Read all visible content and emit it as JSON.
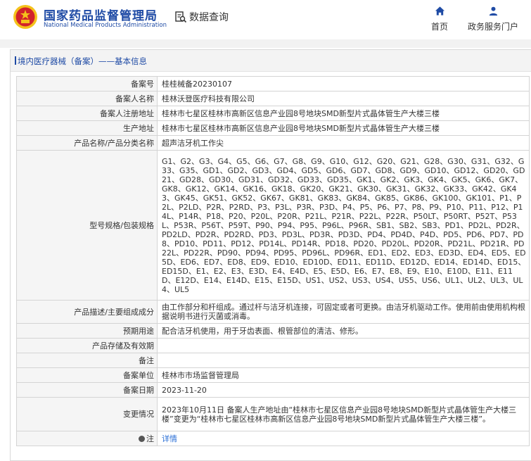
{
  "header": {
    "site_name_cn": "国家药品监督管理局",
    "site_name_en": "National Medical Products Administration",
    "data_query_label": "数据查询",
    "nav_home": "首页",
    "nav_portal": "政务服务门户"
  },
  "breadcrumb": {
    "text": "境内医疗器械（备案）——基本信息"
  },
  "record": {
    "rows": [
      {
        "label": "备案号",
        "value": "桂桂械备20230107"
      },
      {
        "label": "备案人名称",
        "value": "桂林沃登医疗科技有限公司"
      },
      {
        "label": "备案人注册地址",
        "value": "桂林市七星区桂林市高新区信息产业园8号地块SMD新型片式晶体管生产大楼三楼"
      },
      {
        "label": "生产地址",
        "value": "桂林市七星区桂林市高新区信息产业园8号地块SMD新型片式晶体管生产大楼三楼"
      },
      {
        "label": "产品名称/产品分类名称",
        "value": "超声洁牙机工作尖"
      },
      {
        "label": "型号规格/包装规格",
        "value": "G1、G2、G3、G4、G5、G6、G7、G8、G9、G10、G12、G20、G21、G28、G30、G31、G32、G33、G35、GD1、GD2、GD3、GD4、GD5、GD6、GD7、GD8、GD9、GD10、GD12、GD20、GD21、GD28、GD30、GD31、GD32、GD33、GD35、GK1、GK2、GK3、GK4、GK5、GK6、GK7、GK8、GK12、GK14、GK16、GK18、GK20、GK21、GK30、GK31、GK32、GK33、GK42、GK43、GK45、GK51、GK52、GK67、GK81、GK83、GK84、GK85、GK86、GK100、GK101、P1、P2L、P2LD、P2R、P2RD、P3、P3L、P3R、P3D、P4、P5、P6、P7、P8、P9、P10、P11、P12、P14L、P14R、P18、P20、P20L、P20R、P21L、P21R、P22L、P22R、P50LT、P50RT、P52T、P53L、P53R、P56T、P59T、P90、P94、P95、P96L、P96R、SB1、SB2、SB3、PD1、PD2L、PD2R、PD2LD、PD2R、PD2RD、PD3、PD3L、PD3R、PD3D、PD4、PD4D、P4D、PD5、PD6、PD7、PD8、PD10、PD11、PD12、PD14L、PD14R、PD18、PD20、PD20L、PD20R、PD21L、PD21R、PD22L、PD22R、PD90、PD94、PD95、PD96L、PD96R、ED1、ED2、ED3、ED3D、ED4、ED5、ED5D、ED6、ED7、ED8、ED9、ED10、ED10D、ED11、ED11D、ED12D、ED14、ED14D、ED15、ED15D、E1、E2、E3、E3D、E4、E4D、E5、E5D、E6、E7、E8、E9、E10、E10D、E11、E11D、E12D、E14、E14D、E15、E15D、US1、US2、US3、US4、US5、US6、UL1、UL2、UL3、UL4、UL5"
      },
      {
        "label": "产品描述/主要组成成分",
        "value": "由工作部分和杆组成。通过杆与洁牙机连接，可固定或者可更换。由洁牙机驱动工作。使用前由使用机构根据说明书进行灭菌或消毒。"
      },
      {
        "label": "预期用途",
        "value": "配合洁牙机使用，用于牙齿表面、根管部位的清洁、修形。"
      },
      {
        "label": "产品存储及有效期",
        "value": ""
      },
      {
        "label": "备注",
        "value": ""
      },
      {
        "label": "备案单位",
        "value": "桂林市市场监督管理局"
      },
      {
        "label": "备案日期",
        "value": "2023-11-20"
      },
      {
        "label": "变更情况",
        "value": "2023年10月11日 备案人生产地址由“桂林市七星区信息产业园8号地块SMD新型片式晶体管生产大楼三楼”变更为“桂林市七星区桂林市高新区信息产业园8号地块SMD新型片式晶体管生产大楼三楼”。"
      }
    ],
    "note_label": "注",
    "details_link": "详情"
  },
  "colors": {
    "brand_blue": "#1f4ba5",
    "link_blue": "#2a6fd6",
    "emblem_red": "#d2232a",
    "emblem_gold": "#f4c21b"
  },
  "icons": {
    "emblem": "national-emblem-icon",
    "data_query": "search-document-icon",
    "home": "home-icon",
    "portal": "user-icon",
    "note": "bulb-icon"
  }
}
